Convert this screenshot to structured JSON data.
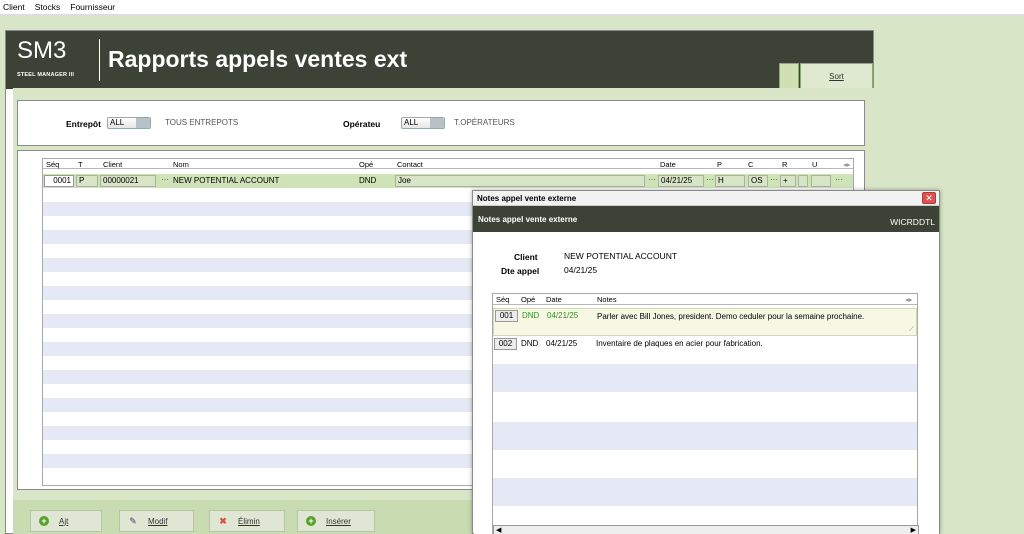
{
  "menu": [
    "Client",
    "Stocks",
    "Fournisseur"
  ],
  "logo": {
    "big": "SM3",
    "small": "STEEL MANAGER III"
  },
  "window_title": "Rapports appels ventes ext",
  "sort_tab": "Sort",
  "filters": {
    "entrepot_label": "Entrepôt",
    "entrepot_value": "ALL",
    "entrepot_desc": "TOUS ENTREPOTS",
    "operateur_label": "Opérateu",
    "operateur_value": "ALL",
    "operateur_desc": "T.OPÉRATEURS"
  },
  "grid": {
    "headers": [
      "Séq",
      "T",
      "Client",
      "Nom",
      "Opé",
      "Contact",
      "Date",
      "P",
      "C",
      "R",
      "U"
    ],
    "rows": [
      {
        "seq": "0001",
        "t": "P",
        "client": "00000021",
        "nom": "NEW POTENTIAL ACCOUNT",
        "ope": "DND",
        "contact": "Joe",
        "date": "04/21/25",
        "p": "H",
        "c": "OS",
        "r": "+",
        "u": ""
      }
    ]
  },
  "buttons": {
    "add": "Ajt",
    "modify": "Modif",
    "delete": "Élimin",
    "insert": "Insérer"
  },
  "dialog": {
    "window_title": "Notes appel vente externe",
    "header_title": "Notes appel vente externe",
    "code": "WICRDDTL",
    "client_label": "Client",
    "client_value": "NEW POTENTIAL ACCOUNT",
    "date_label": "Dte appel",
    "date_value": "04/21/25",
    "notes_headers": [
      "Séq",
      "Opé",
      "Date",
      "Notes"
    ],
    "notes": [
      {
        "seq": "001",
        "ope": "DND",
        "date": "04/21/25",
        "note": "Parler avec Bill Jones, president. Demo ceduler pour la semaine prochaine."
      },
      {
        "seq": "002",
        "ope": "DND",
        "date": "04/21/25",
        "note": "Inventaire de plaques en acier pour fabrication."
      }
    ]
  }
}
